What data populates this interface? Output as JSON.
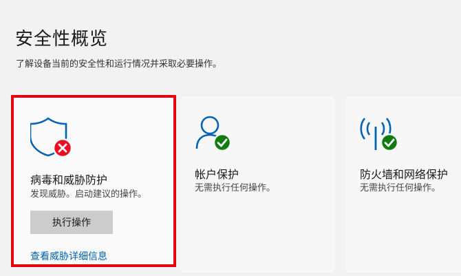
{
  "header": {
    "title": "安全性概览",
    "description": "了解设备当前的安全性和运行情况并采取必要操作。"
  },
  "cards": [
    {
      "title": "病毒和威胁防护",
      "status": "发现威胁。启动建议的操作。",
      "icon": "shield-icon",
      "badge": "error-badge-icon",
      "action_label": "执行操作",
      "link_label": "查看威胁详细信息"
    },
    {
      "title": "帐户保护",
      "status": "无需执行任何操作。",
      "icon": "person-icon",
      "badge": "ok-badge-icon"
    },
    {
      "title": "防火墙和网络保护",
      "status": "无需执行任何操作。",
      "icon": "wireless-antenna-icon",
      "badge": "ok-badge-icon"
    }
  ],
  "colors": {
    "accent_blue": "#0063b1",
    "error_red": "#e81123",
    "ok_green": "#107c10",
    "alert_border": "#e50012"
  }
}
